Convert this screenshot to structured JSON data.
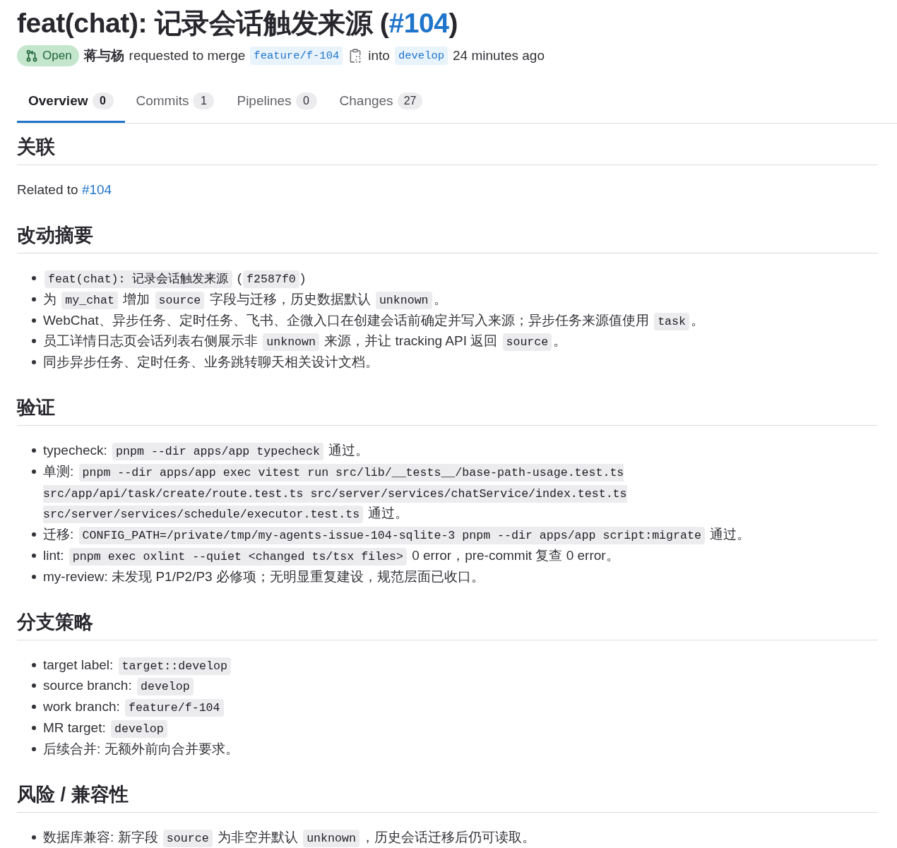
{
  "merge_request": {
    "title": [
      {
        "kind": "text",
        "text": "feat(chat): 记录会话触发来源 ("
      },
      {
        "kind": "link",
        "text": "#104"
      },
      {
        "kind": "text",
        "text": ")"
      }
    ],
    "status": {
      "kind": "open",
      "label": "Open"
    },
    "author": "蒋与杨",
    "action": "requested to merge",
    "source_branch": "feature/f-104",
    "connector": "into",
    "target_branch": "develop",
    "time": "24 minutes ago"
  },
  "tabs": [
    {
      "label": "Overview",
      "count": "0",
      "selected": true
    },
    {
      "label": "Commits",
      "count": "1",
      "selected": false
    },
    {
      "label": "Pipelines",
      "count": "0",
      "selected": false
    },
    {
      "label": "Changes",
      "count": "27",
      "selected": false
    }
  ],
  "description": [
    {
      "heading": "关联",
      "blocks": [
        {
          "kind": "paragraph",
          "parts": [
            {
              "kind": "text",
              "text": "Related to "
            },
            {
              "kind": "link",
              "text": "#104"
            }
          ]
        }
      ]
    },
    {
      "heading": "改动摘要",
      "blocks": [
        {
          "kind": "list",
          "items": [
            {
              "parts": [
                {
                  "kind": "code",
                  "text": "feat(chat): 记录会话触发来源"
                },
                {
                  "kind": "text",
                  "text": " ("
                },
                {
                  "kind": "code",
                  "text": "f2587f0"
                },
                {
                  "kind": "text",
                  "text": ")"
                }
              ]
            },
            {
              "parts": [
                {
                  "kind": "text",
                  "text": "为 "
                },
                {
                  "kind": "code",
                  "text": "my_chat"
                },
                {
                  "kind": "text",
                  "text": " 增加 "
                },
                {
                  "kind": "code",
                  "text": "source"
                },
                {
                  "kind": "text",
                  "text": " 字段与迁移，历史数据默认 "
                },
                {
                  "kind": "code",
                  "text": "unknown"
                },
                {
                  "kind": "text",
                  "text": "。"
                }
              ]
            },
            {
              "parts": [
                {
                  "kind": "text",
                  "text": "WebChat、异步任务、定时任务、飞书、企微入口在创建会话前确定并写入来源；异步任务来源值使用 "
                },
                {
                  "kind": "code",
                  "text": "task"
                },
                {
                  "kind": "text",
                  "text": "。"
                }
              ]
            },
            {
              "parts": [
                {
                  "kind": "text",
                  "text": "员工详情日志页会话列表右侧展示非 "
                },
                {
                  "kind": "code",
                  "text": "unknown"
                },
                {
                  "kind": "text",
                  "text": " 来源，并让 tracking API 返回 "
                },
                {
                  "kind": "code",
                  "text": "source"
                },
                {
                  "kind": "text",
                  "text": "。"
                }
              ]
            },
            {
              "parts": [
                {
                  "kind": "text",
                  "text": "同步异步任务、定时任务、业务跳转聊天相关设计文档。"
                }
              ]
            }
          ]
        }
      ]
    },
    {
      "heading": "验证",
      "blocks": [
        {
          "kind": "list",
          "items": [
            {
              "parts": [
                {
                  "kind": "text",
                  "text": "typecheck: "
                },
                {
                  "kind": "code",
                  "text": "pnpm --dir apps/app typecheck"
                },
                {
                  "kind": "text",
                  "text": " 通过。"
                }
              ]
            },
            {
              "parts": [
                {
                  "kind": "text",
                  "text": "单测: "
                },
                {
                  "kind": "code",
                  "text": "pnpm --dir apps/app exec vitest run src/lib/__tests__/base-path-usage.test.ts src/app/api/task/create/route.test.ts src/server/services/chatService/index.test.ts src/server/services/schedule/executor.test.ts"
                },
                {
                  "kind": "text",
                  "text": " 通过。"
                }
              ]
            },
            {
              "parts": [
                {
                  "kind": "text",
                  "text": "迁移: "
                },
                {
                  "kind": "code",
                  "text": "CONFIG_PATH=/private/tmp/my-agents-issue-104-sqlite-3 pnpm --dir apps/app script:migrate"
                },
                {
                  "kind": "text",
                  "text": " 通过。"
                }
              ]
            },
            {
              "parts": [
                {
                  "kind": "text",
                  "text": "lint: "
                },
                {
                  "kind": "code",
                  "text": "pnpm exec oxlint --quiet <changed ts/tsx files>"
                },
                {
                  "kind": "text",
                  "text": " 0 error，pre-commit 复查 0 error。"
                }
              ]
            },
            {
              "parts": [
                {
                  "kind": "text",
                  "text": "my-review: 未发现 P1/P2/P3 必修项；无明显重复建设，规范层面已收口。"
                }
              ]
            }
          ]
        }
      ]
    },
    {
      "heading": "分支策略",
      "blocks": [
        {
          "kind": "list",
          "items": [
            {
              "parts": [
                {
                  "kind": "text",
                  "text": "target label: "
                },
                {
                  "kind": "code",
                  "text": "target::develop"
                }
              ]
            },
            {
              "parts": [
                {
                  "kind": "text",
                  "text": "source branch: "
                },
                {
                  "kind": "code",
                  "text": "develop"
                }
              ]
            },
            {
              "parts": [
                {
                  "kind": "text",
                  "text": "work branch: "
                },
                {
                  "kind": "code",
                  "text": "feature/f-104"
                }
              ]
            },
            {
              "parts": [
                {
                  "kind": "text",
                  "text": "MR target: "
                },
                {
                  "kind": "code",
                  "text": "develop"
                }
              ]
            },
            {
              "parts": [
                {
                  "kind": "text",
                  "text": "后续合并: 无额外前向合并要求。"
                }
              ]
            }
          ]
        }
      ]
    },
    {
      "heading": "风险 / 兼容性",
      "blocks": [
        {
          "kind": "list",
          "items": [
            {
              "parts": [
                {
                  "kind": "text",
                  "text": "数据库兼容: 新字段 "
                },
                {
                  "kind": "code",
                  "text": "source"
                },
                {
                  "kind": "text",
                  "text": " 为非空并默认 "
                },
                {
                  "kind": "code",
                  "text": "unknown"
                },
                {
                  "kind": "text",
                  "text": "，历史会话迁移后仍可读取。"
                }
              ]
            }
          ]
        }
      ]
    }
  ]
}
